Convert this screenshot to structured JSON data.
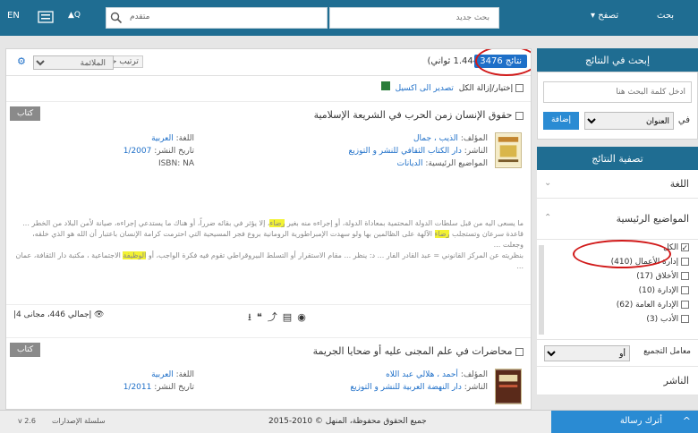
{
  "topbar": {
    "lang": "EN",
    "advanced": "▲Q",
    "search_mode": "متقدم",
    "search_placeholder": "بحث جديد",
    "browse": "تصفح ▾",
    "search": "بحث"
  },
  "results": {
    "count": "3476 نتائج",
    "seconds": "(1.444 ثواني)",
    "sort_label": "ترتيب حسب",
    "sort_value": "الملائمة"
  },
  "selection": {
    "select_all": "إختيار/إزالة الكل",
    "export": "تصدير الى اكسيل"
  },
  "records": [
    {
      "title": "حقوق الإنسان زمن الحرب في الشريعة الإسلامية",
      "badge": "كتاب",
      "author_label": "المؤلف:",
      "author": "الذيب ، جمال",
      "publisher_label": "الناشر:",
      "publisher": "دار الكتاب الثقافي للنشر و التوزيع",
      "subjects_label": "المواضيع الرئيسية:",
      "subjects": "الديانات",
      "language_label": "اللغة:",
      "language": "العربية",
      "date_label": "تاريخ النشر:",
      "date": "1/2007",
      "isbn": "ISBN: NA",
      "ex1a": "ما يسعى اليه من قبل سلطات الدولة المحتمية بمعاداة الدولة، أو إجراءه منه بغير ",
      "ex1h": "رضاء",
      "ex1b": "، إلا يؤثر في بقائه ضرراً، أو هناك ما يستدعي إجراءه، صيانة لأمن البلاد من الخطر ...",
      "ex2a": "قاعدة سرعان وتستجلب ",
      "ex2h": "رضاء",
      "ex2b": " الآلهة على الظالمين بها ولو سهدت الإمبراطورية الرومانية بروع فجر المسيحية التي احترمت كرامة الإنسان باعتبار أن الله هو الذي خلقه، وجعلت ...",
      "ex3a": "بنظريته عن المركز القانوني = عبد القادر الفار ... د: ينظر ... مقام الاستقرار أو التسلط البيروقراطي تقوم فيه فكرة الواجب، أو ",
      "ex3h": "الوظيفة",
      "ex3b": " الاجتماعية ، مكتبة دار الثقافة، عمان ...",
      "views": "إجمالي 446، مجانى 4|"
    },
    {
      "title": "محاضرات في علم المجنى عليه أو ضحايا الجريمة",
      "badge": "كتاب",
      "author_label": "المؤلف:",
      "author": "أحمد ، هلالي عبد اللاه",
      "publisher_label": "الناشر:",
      "publisher": "دار النهضة العربية للنشر و التوزيع",
      "language_label": "اللغة:",
      "language": "العربية",
      "date_label": "تاريخ النشر:",
      "date": "1/2011"
    }
  ],
  "sidebar": {
    "search_in_results": "إبحث في النتائج",
    "search_placeholder": "أدخل كلمة البحث هنا",
    "in_label": "في",
    "field": "العنوان",
    "add": "إضافة",
    "filter_results": "تصفية النتائج",
    "language": "اللغة",
    "subjects": "المواضيع الرئيسية",
    "items": [
      {
        "label": "الكل"
      },
      {
        "label": "إدارة الأعمال (410)"
      },
      {
        "label": "الأخلاق (17)"
      },
      {
        "label": "الإدارة (10)"
      },
      {
        "label": "الإدارة العامة (62)"
      },
      {
        "label": "الأدب (3)"
      }
    ],
    "combine_label": "معامل التجميع",
    "combine_value": "أو",
    "next_partial": "الناشر"
  },
  "footer": {
    "version": "v 2.6",
    "series": "سلسلة الإصدارات",
    "copyright": "جميع الحقوق محفوظة، المنهل © 2010-2015",
    "chat": "أترك رسالة"
  }
}
